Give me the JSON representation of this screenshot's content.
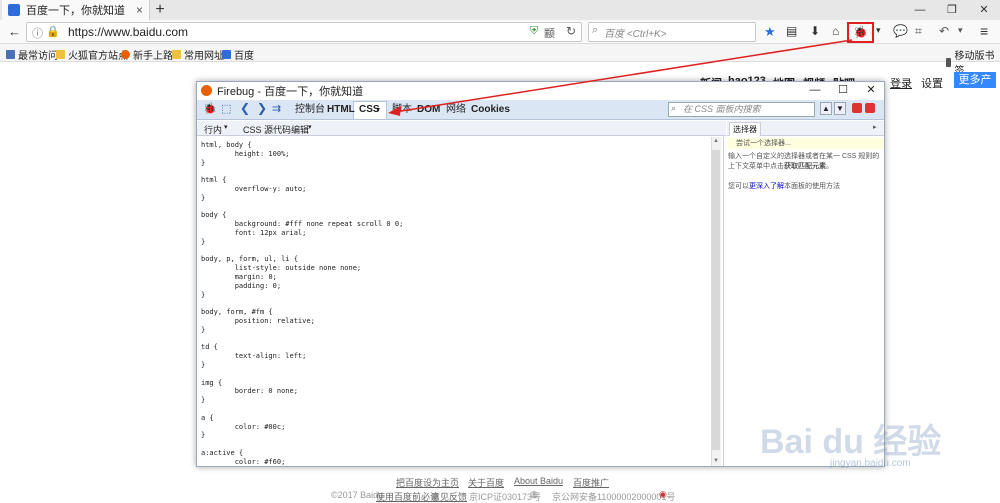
{
  "tab": {
    "title": "百度一下，你就知道",
    "close": "×"
  },
  "newtab": "+",
  "window_controls": [
    "—",
    "❐",
    "✕"
  ],
  "nav": {
    "url": "https://www.baidu.com",
    "search_placeholder": "百度 <Ctrl+K>",
    "reader": "颛"
  },
  "bookmarks": [
    "最常访问",
    "火狐官方站点",
    "新手上路",
    "常用网址",
    "百度",
    "移动版书签"
  ],
  "baidu_top": {
    "links": [
      "新闻",
      "hao123",
      "地图",
      "视频",
      "贴吧"
    ],
    "login": "登录",
    "settings": "设置",
    "more": "更多产品"
  },
  "firebug": {
    "title": "Firebug - 百度一下，你就知道",
    "tabs": [
      "控制台",
      "HTML",
      "CSS",
      "脚本",
      "DOM",
      "网络",
      "Cookies"
    ],
    "search_placeholder": "在 CSS 面板内搜索",
    "sub_left": "行内",
    "sub_edit": "CSS 源代码编辑",
    "side_tab": "选择器",
    "side_input": "尝试一个选择器...",
    "side_help1": "输入一个自定义的选择器或者在某一 CSS 规则的上下文菜单中点击",
    "side_help_bold": "获取匹配元素",
    "side_help2": "。",
    "side_more_pre": "您可以",
    "side_more_link": "更深入了解",
    "side_more_post": "本面板的使用方法",
    "code": "html, body {\n        height: 100%;\n}\n\nhtml {\n        overflow-y: auto;\n}\n\nbody {\n        background: #fff none repeat scroll 0 0;\n        font: 12px arial;\n}\n\nbody, p, form, ul, li {\n        list-style: outside none none;\n        margin: 0;\n        padding: 0;\n}\n\nbody, form, #fm {\n        position: relative;\n}\n\ntd {\n        text-align: left;\n}\n\nimg {\n        border: 0 none;\n}\n\na {\n        color: #00c;\n}\n\na:active {\n        color: #f60;"
  },
  "footer": {
    "links": [
      "把百度设为主页",
      "关于百度",
      "About Baidu",
      "百度推广"
    ],
    "copyright": "©2017 Baidu",
    "legal": [
      "使用百度前必读",
      "意见反馈",
      "京ICP证030173号"
    ],
    "police": "京公网安备11000002000001号"
  },
  "watermark": {
    "main": "Bai du 经验",
    "sub": "jingyan.baidu.com"
  },
  "colors": {
    "accent": "#3388ff",
    "highlight": "#e02020",
    "firebug_toolbar": "#dbe6f4"
  }
}
